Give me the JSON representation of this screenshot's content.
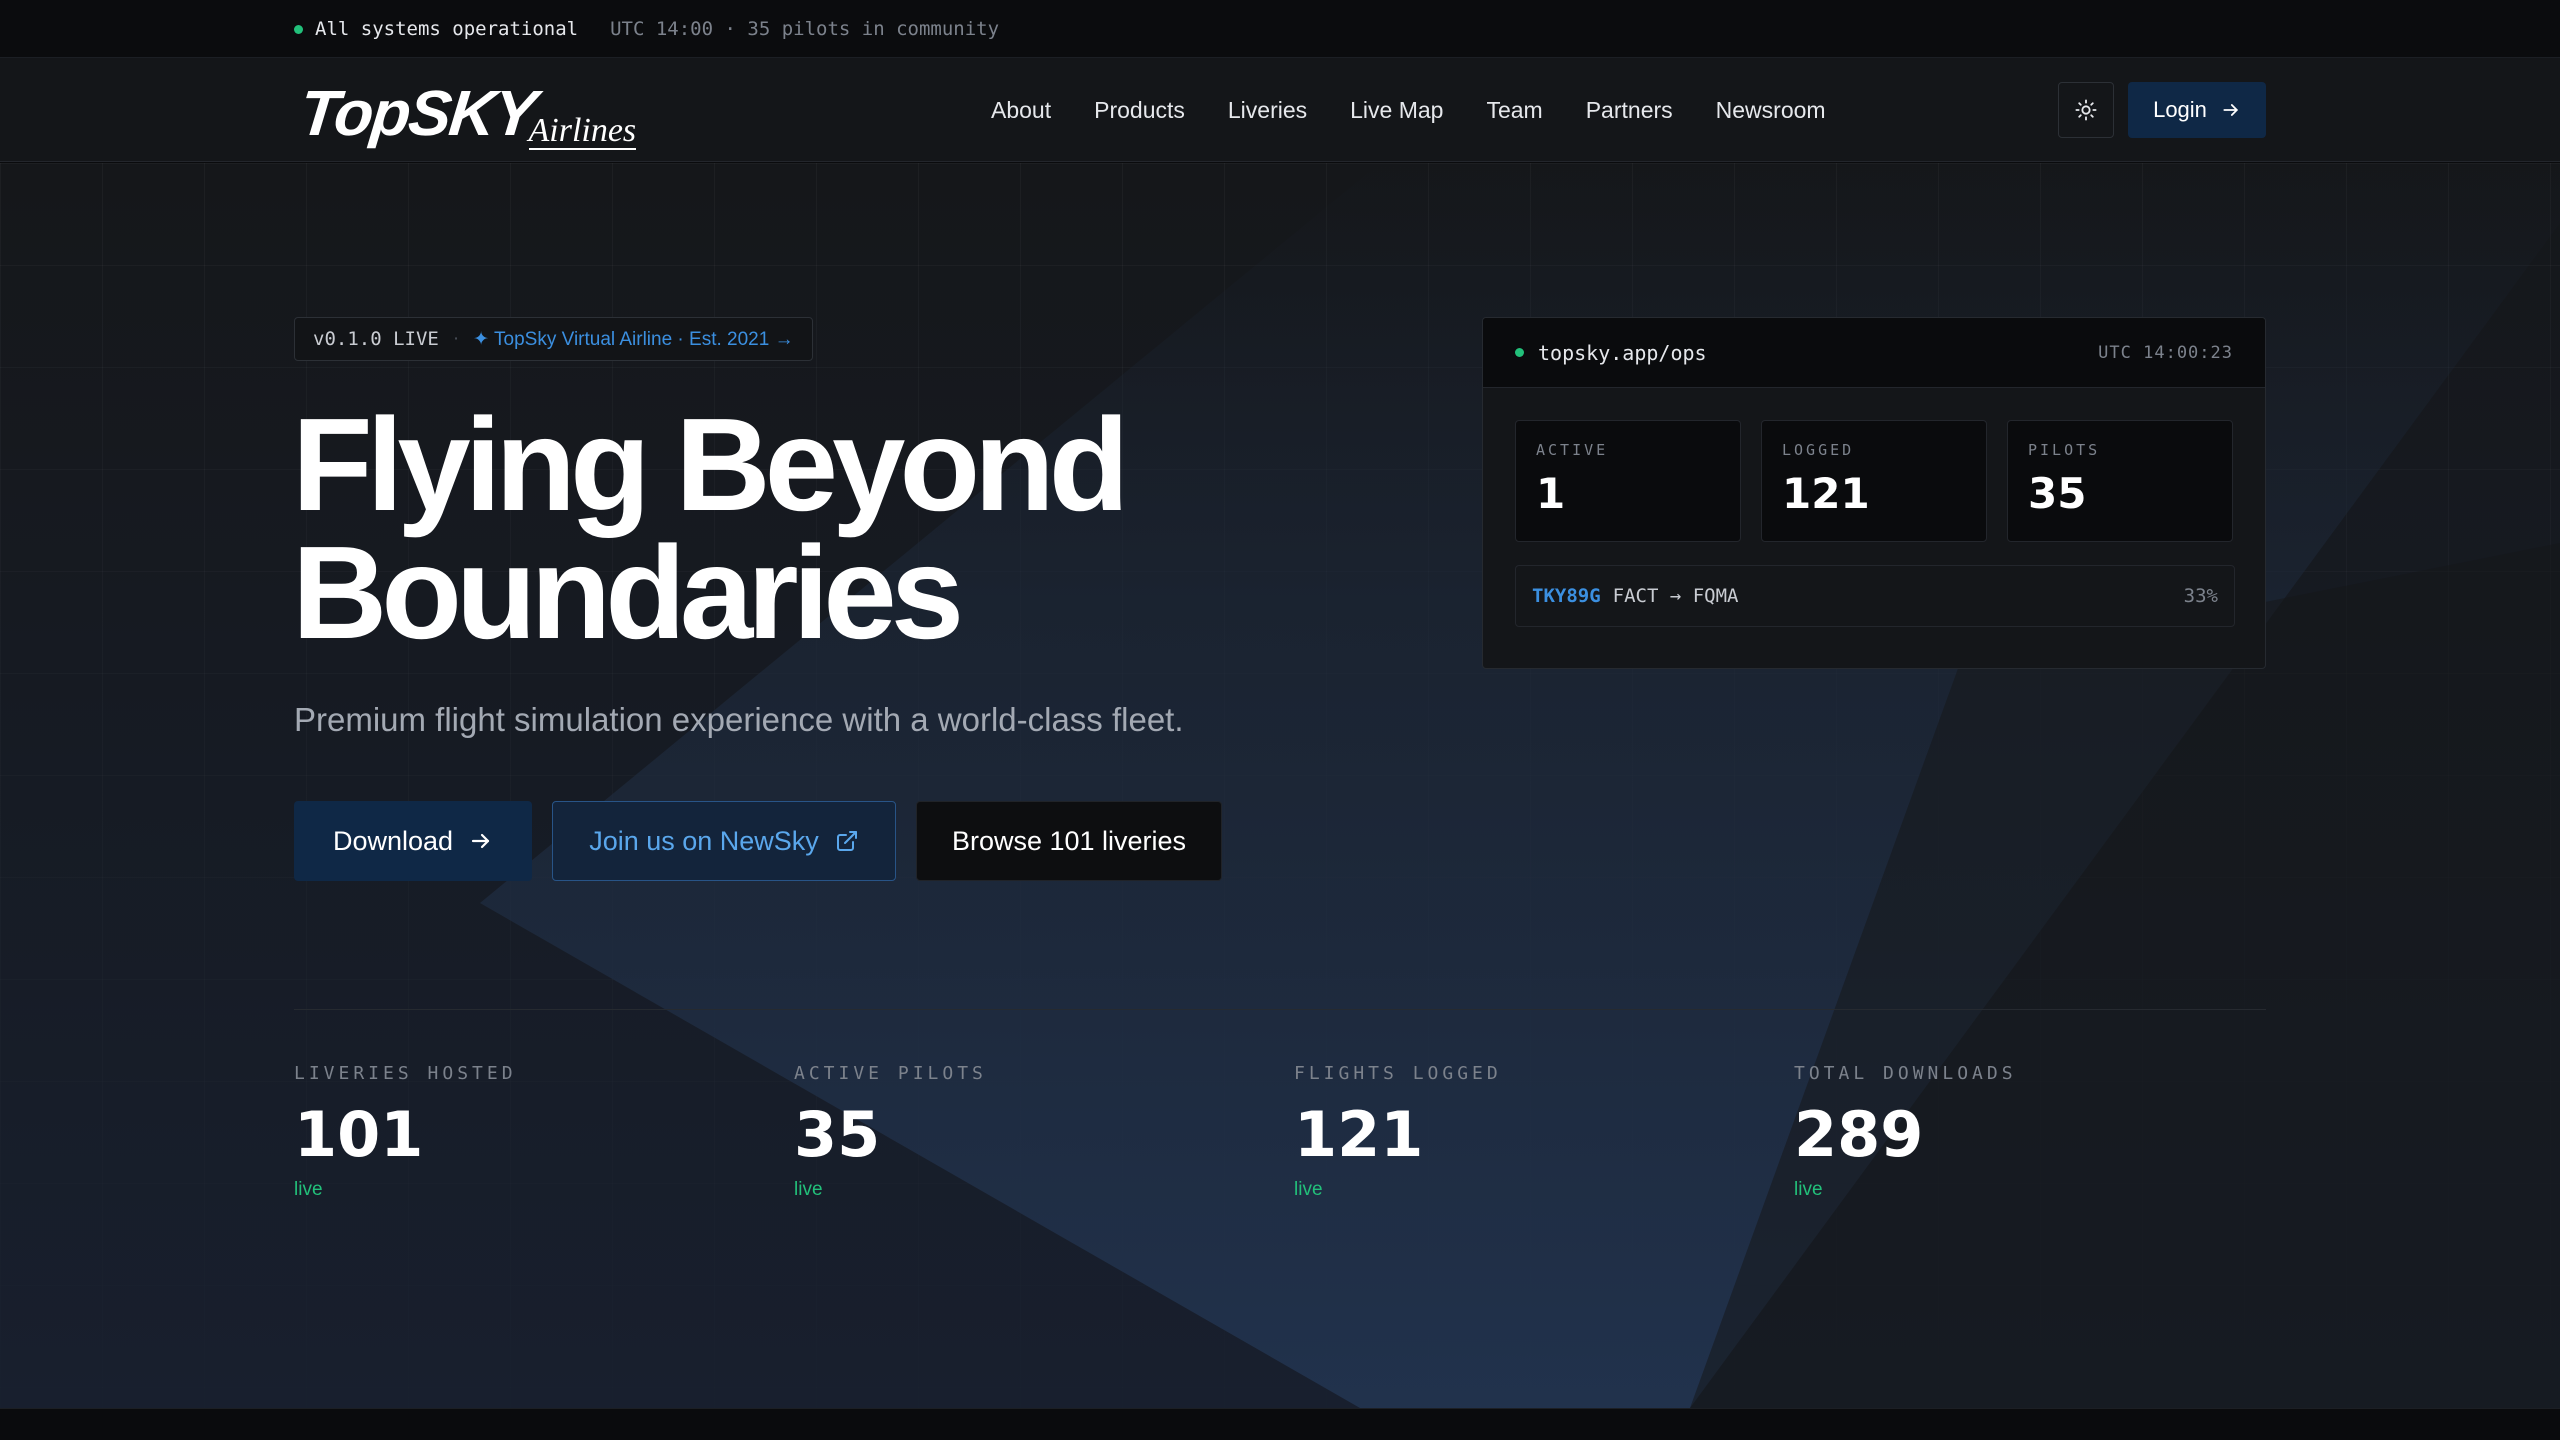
{
  "status_bar": {
    "status": "All systems operational",
    "meta": "UTC 14:00 · 35 pilots in community"
  },
  "brand": {
    "name": "TopSKY",
    "sub": "Airlines"
  },
  "nav": {
    "links": [
      "About",
      "Products",
      "Liveries",
      "Live Map",
      "Team",
      "Partners",
      "Newsroom"
    ],
    "login_label": "Login"
  },
  "hero": {
    "version": "v0.1.0 LIVE",
    "badge": "✦ TopSky Virtual Airline · Est. 2021 →",
    "title_line1": "Flying Beyond",
    "title_line2": "Boundaries",
    "subtitle": "Premium flight simulation experience with a world-class fleet.",
    "cta_download": "Download",
    "cta_newsky": "Join us on NewSky",
    "cta_liveries": "Browse 101 liveries"
  },
  "ops": {
    "url": "topsky.app/ops",
    "time": "UTC 14:00:23",
    "stats": [
      {
        "label": "ACTIVE",
        "value": "1"
      },
      {
        "label": "LOGGED",
        "value": "121"
      },
      {
        "label": "PILOTS",
        "value": "35"
      }
    ],
    "flight": {
      "callsign": "TKY89G",
      "route": "FACT → FQMA",
      "progress": "33%"
    }
  },
  "stats": [
    {
      "label": "LIVERIES HOSTED",
      "value": "101",
      "note": "live"
    },
    {
      "label": "ACTIVE PILOTS",
      "value": "35",
      "note": "live"
    },
    {
      "label": "FLIGHTS LOGGED",
      "value": "121",
      "note": "live"
    },
    {
      "label": "TOTAL DOWNLOADS",
      "value": "289",
      "note": "live"
    }
  ],
  "colors": {
    "accent": "#0f2846",
    "link": "#3b8fe0",
    "ok": "#22c07a"
  }
}
